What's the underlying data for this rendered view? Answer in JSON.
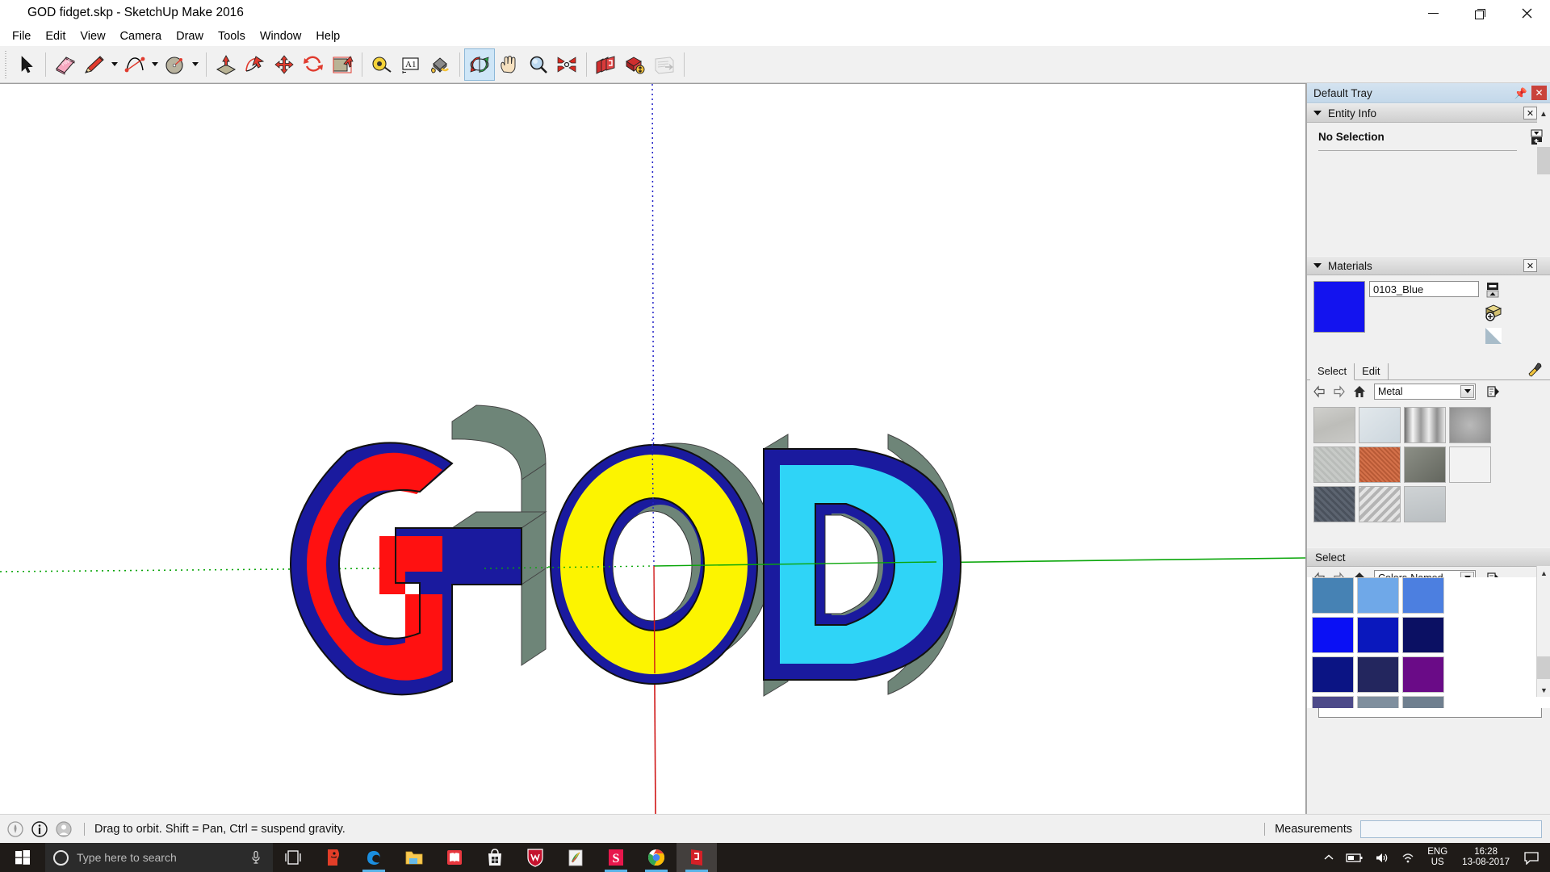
{
  "window": {
    "title": "GOD fidget.skp - SketchUp Make 2016",
    "icon": "sketchup-logo-icon",
    "minimize_label": "–",
    "maximize_label": "❐",
    "close_label": "✕"
  },
  "menubar": {
    "items": [
      {
        "label": "File"
      },
      {
        "label": "Edit"
      },
      {
        "label": "View"
      },
      {
        "label": "Camera"
      },
      {
        "label": "Draw"
      },
      {
        "label": "Tools"
      },
      {
        "label": "Window"
      },
      {
        "label": "Help"
      }
    ]
  },
  "toolbar": {
    "groups": [
      {
        "tools": [
          {
            "name": "select-arrow-tool",
            "icon": "cursor-arrow-icon",
            "active": false,
            "dropdown": false
          }
        ]
      },
      {
        "tools": [
          {
            "name": "eraser-tool",
            "icon": "eraser-icon",
            "active": false,
            "dropdown": false
          },
          {
            "name": "line-tool",
            "icon": "pencil-icon",
            "active": false,
            "dropdown": true
          },
          {
            "name": "arc-tool",
            "icon": "arc-icon",
            "active": false,
            "dropdown": true
          },
          {
            "name": "circle-tool",
            "icon": "circle-shape-icon",
            "active": false,
            "dropdown": true
          }
        ]
      },
      {
        "tools": [
          {
            "name": "pushpull-tool",
            "icon": "pushpull-icon",
            "active": false,
            "dropdown": false
          },
          {
            "name": "followme-tool",
            "icon": "followme-icon",
            "active": false,
            "dropdown": false
          },
          {
            "name": "move-tool",
            "icon": "move-arrows-icon",
            "active": false,
            "dropdown": false
          },
          {
            "name": "rotate-tool",
            "icon": "rotate-icon",
            "active": false,
            "dropdown": false
          },
          {
            "name": "scale-tool",
            "icon": "scale-icon",
            "active": false,
            "dropdown": false
          }
        ]
      },
      {
        "tools": [
          {
            "name": "tape-measure-tool",
            "icon": "tape-measure-icon",
            "active": false,
            "dropdown": false
          },
          {
            "name": "text-tool",
            "icon": "text-a1-icon",
            "active": false,
            "dropdown": false
          },
          {
            "name": "paint-bucket-tool",
            "icon": "paint-bucket-icon",
            "active": false,
            "dropdown": false
          }
        ]
      },
      {
        "tools": [
          {
            "name": "orbit-tool",
            "icon": "orbit-icon",
            "active": true,
            "dropdown": false
          },
          {
            "name": "pan-tool",
            "icon": "hand-pan-icon",
            "active": false,
            "dropdown": false
          },
          {
            "name": "zoom-tool",
            "icon": "magnifier-zoom-icon",
            "active": false,
            "dropdown": false
          },
          {
            "name": "zoom-extents-tool",
            "icon": "zoom-extents-icon",
            "active": false,
            "dropdown": false
          }
        ]
      },
      {
        "tools": [
          {
            "name": "3d-warehouse-button",
            "icon": "warehouse-icon",
            "active": false,
            "dropdown": false
          },
          {
            "name": "share-model-button",
            "icon": "share-model-icon",
            "active": false,
            "dropdown": false
          },
          {
            "name": "extension-warehouse-button",
            "icon": "extension-warehouse-icon",
            "active": false,
            "dropdown": false
          }
        ]
      }
    ]
  },
  "viewport": {
    "model_text": "GOD",
    "letters": [
      {
        "char": "G",
        "face_color": "#ff1111",
        "outline_color": "#1a1a9e",
        "side_color": "#6e8578"
      },
      {
        "char": "O",
        "face_color": "#fcf400",
        "outline_color": "#1a1a9e",
        "side_color": "#6e8578"
      },
      {
        "char": "D",
        "face_color": "#2fd4f7",
        "outline_color": "#1a1a9e",
        "side_color": "#6e8578"
      }
    ],
    "axes": {
      "green_axis_color": "#0aa60a",
      "blue_axis_color": "#2222c8",
      "red_axis_color": "#d01818"
    },
    "background_color": "#ffffff"
  },
  "tray": {
    "title": "Default Tray",
    "pin_icon": "pin-icon",
    "close_icon": "close-icon",
    "panels": {
      "entity_info": {
        "title": "Entity Info",
        "status": "No Selection",
        "collapse_icon": "triangle-down-icon",
        "close_icon": "close-icon",
        "expand_icon": "expand-details-icon"
      },
      "materials": {
        "title": "Materials",
        "close_icon": "close-icon",
        "current_material_name": "0103_Blue",
        "current_material_color": "#1313ef",
        "side_icons": [
          "display-secondary-icon",
          "create-material-icon",
          "set-opacity-icon"
        ],
        "tabs": [
          {
            "label": "Select",
            "selected": true
          },
          {
            "label": "Edit",
            "selected": false
          }
        ],
        "eyedropper_icon": "eyedropper-icon",
        "nav": {
          "back_icon": "arrow-left-icon",
          "forward_icon": "arrow-right-icon",
          "home_icon": "home-icon",
          "details_icon": "details-arrow-icon"
        },
        "library": "Metal",
        "swatches": [
          "#c4c4c2",
          "#d6dde2",
          "#cfcfcf",
          "#a5a5a5",
          "#bdc0bd",
          "#d4714a",
          "#72756d",
          "#f2f2f2",
          "#5c6470",
          "#d3d3d3",
          "#c2c7ca"
        ]
      },
      "colors": {
        "header": "Select",
        "nav": {
          "back_icon": "arrow-left-icon",
          "forward_icon": "arrow-right-icon",
          "home_icon": "home-icon",
          "details_icon": "details-arrow-icon"
        },
        "library": "Colors-Named",
        "swatches": [
          "#4682b4",
          "#6fa8e8",
          "#4c7fe0",
          "#0a10f5",
          "#0a18bd",
          "#0b1063",
          "#0b1484",
          "#23265e",
          "#6a0b87",
          "#4d4a8a",
          "#7f8f9e",
          "#6f7f8f"
        ],
        "scroll_up_icon": "chevron-up-icon",
        "scroll_down_icon": "chevron-down-icon"
      }
    }
  },
  "statusbar": {
    "icons": [
      "geo-location-icon",
      "info-icon",
      "account-icon"
    ],
    "hint": "Drag to orbit. Shift = Pan, Ctrl = suspend gravity.",
    "measurements_label": "Measurements",
    "measurements_value": "",
    "measurements_placeholder": ""
  },
  "taskbar": {
    "start_icon": "windows-start-icon",
    "search_placeholder": "Type here to search",
    "cortana_icon": "cortana-circle-icon",
    "mic_icon": "microphone-icon",
    "apps": [
      {
        "name": "task-view-button",
        "icon": "task-view-icon",
        "running": false,
        "active": false,
        "color": "#ffffff"
      },
      {
        "name": "taskbar-app-red",
        "icon": "red-app-icon",
        "running": false,
        "active": false,
        "color": "#e23e28"
      },
      {
        "name": "taskbar-edge",
        "icon": "edge-browser-icon",
        "running": true,
        "active": false,
        "color": "#1b8fe0"
      },
      {
        "name": "taskbar-file-explorer",
        "icon": "file-explorer-icon",
        "running": false,
        "active": false,
        "color": "#f8c951"
      },
      {
        "name": "taskbar-reader",
        "icon": "book-app-icon",
        "running": false,
        "active": false,
        "color": "#e8383f"
      },
      {
        "name": "taskbar-store",
        "icon": "microsoft-store-icon",
        "running": false,
        "active": false,
        "color": "#f4f4f4"
      },
      {
        "name": "taskbar-mcafee",
        "icon": "mcafee-shield-icon",
        "running": false,
        "active": false,
        "color": "#c4122e"
      },
      {
        "name": "taskbar-photos",
        "icon": "photos-app-icon",
        "running": false,
        "active": false,
        "color": "#f2f2f2"
      },
      {
        "name": "taskbar-s-app",
        "icon": "s-app-icon",
        "running": true,
        "active": false,
        "color": "#e8174c"
      },
      {
        "name": "taskbar-chrome",
        "icon": "chrome-browser-icon",
        "running": true,
        "active": false,
        "color": "#34a853"
      },
      {
        "name": "taskbar-sketchup",
        "icon": "sketchup-icon",
        "running": true,
        "active": true,
        "color": "#d42027"
      }
    ],
    "tray": {
      "chevron_icon": "chevron-up-icon",
      "battery_icon": "battery-icon",
      "volume_icon": "volume-icon",
      "wifi_icon": "wifi-icon",
      "language_line1": "ENG",
      "language_line2": "US",
      "time": "16:28",
      "date": "13-08-2017",
      "notification_icon": "notification-icon"
    }
  }
}
